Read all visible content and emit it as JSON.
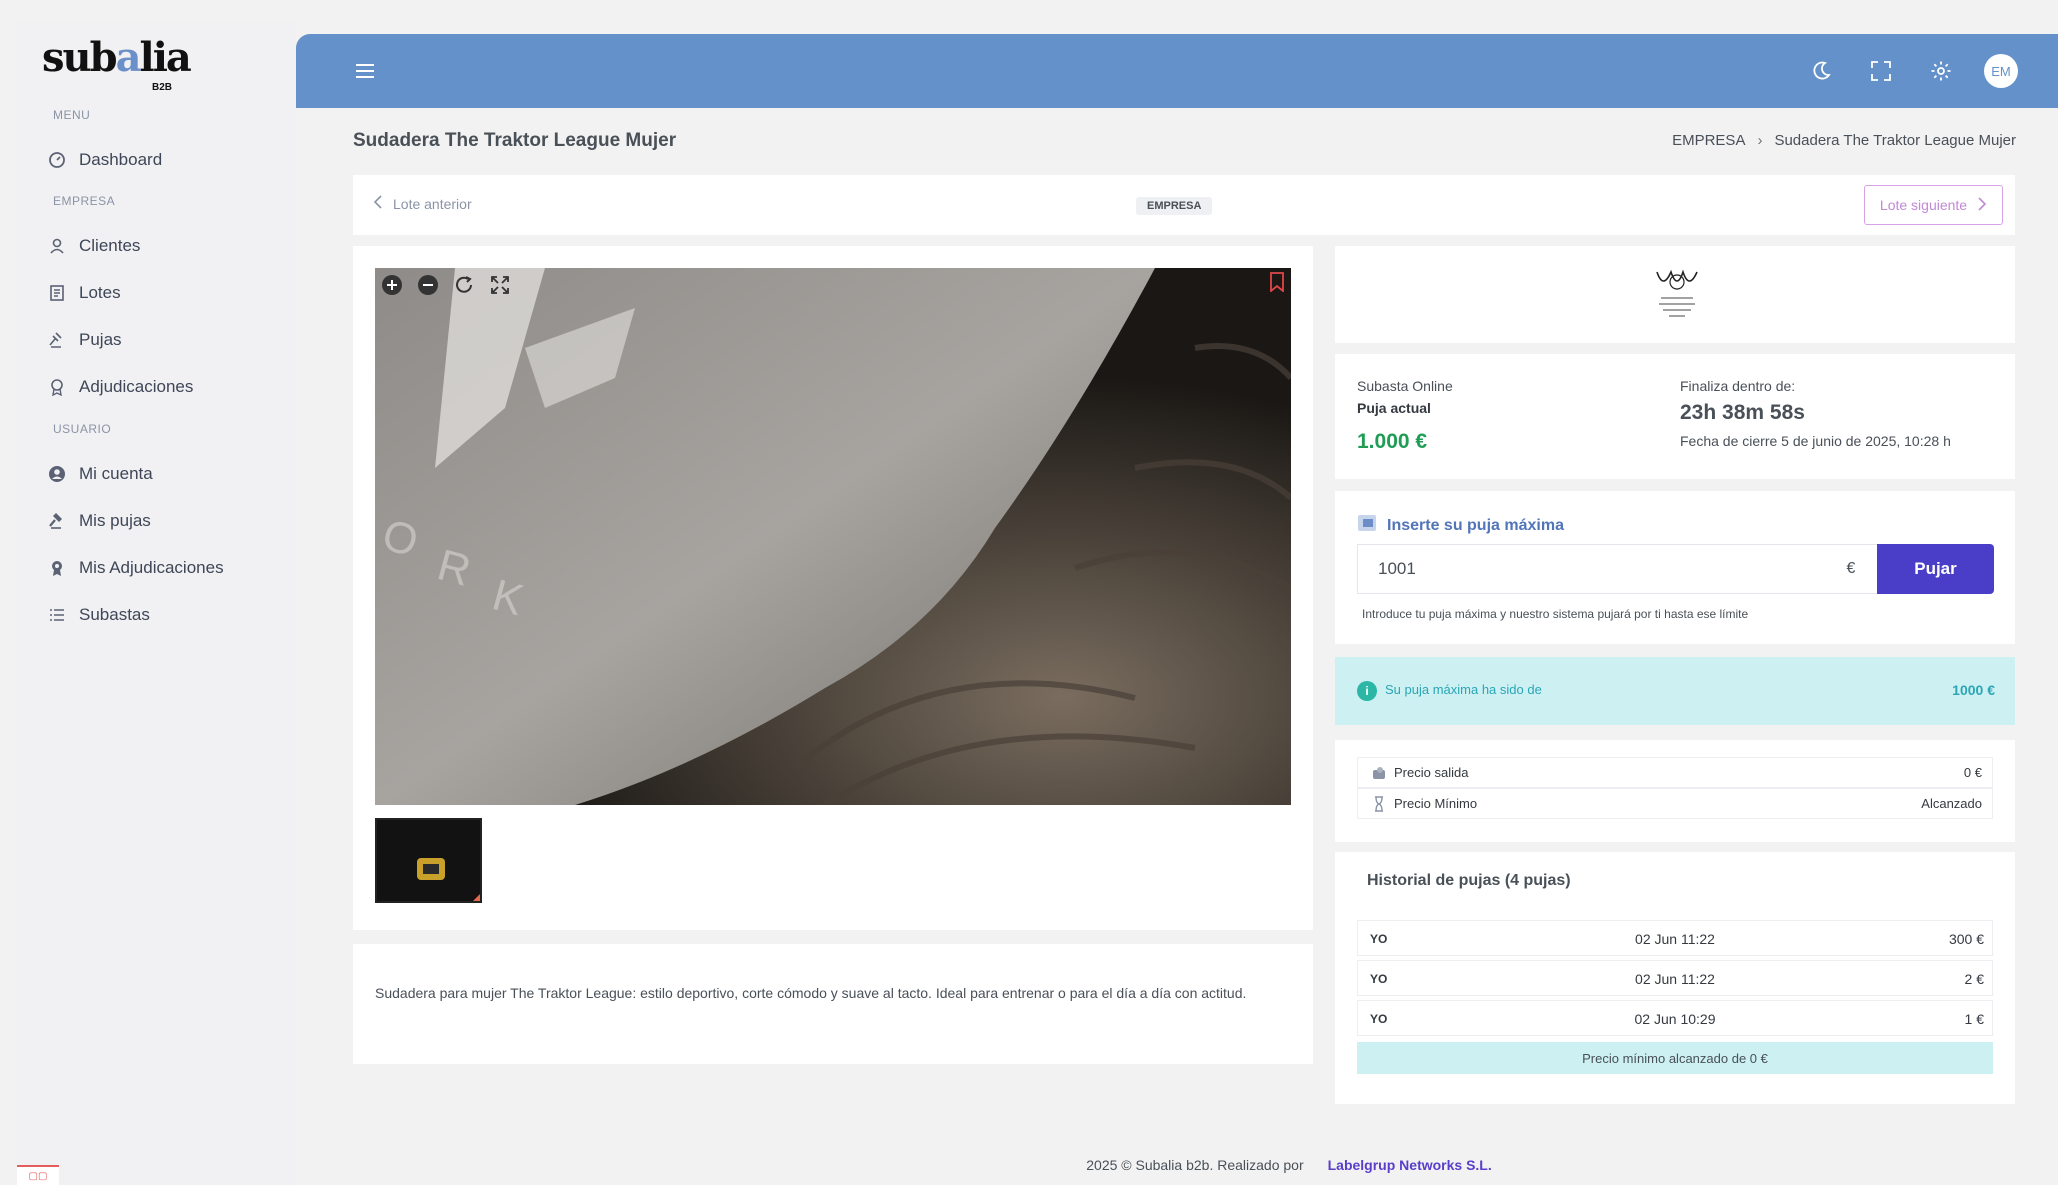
{
  "brand": {
    "logo_main": "subalia",
    "logo_sub": "B2B"
  },
  "sidebar": {
    "sections": [
      {
        "title": "MENU",
        "items": [
          {
            "label": "Dashboard",
            "icon": "dashboard-icon"
          }
        ]
      },
      {
        "title": "EMPRESA",
        "items": [
          {
            "label": "Clientes",
            "icon": "user-icon"
          },
          {
            "label": "Lotes",
            "icon": "document-icon"
          },
          {
            "label": "Pujas",
            "icon": "gavel-icon"
          },
          {
            "label": "Adjudicaciones",
            "icon": "award-icon"
          }
        ]
      },
      {
        "title": "USUARIO",
        "items": [
          {
            "label": "Mi cuenta",
            "icon": "user-circle-icon"
          },
          {
            "label": "Mis pujas",
            "icon": "gavel-solid-icon"
          },
          {
            "label": "Mis Adjudicaciones",
            "icon": "award-solid-icon"
          },
          {
            "label": "Subastas",
            "icon": "list-icon"
          }
        ]
      }
    ]
  },
  "topbar": {
    "avatar_initials": "EM"
  },
  "page": {
    "title": "Sudadera The Traktor League Mujer",
    "breadcrumb": [
      "EMPRESA",
      "Sudadera The Traktor League Mujer"
    ]
  },
  "lot_nav": {
    "prev_label": "Lote anterior",
    "badge": "EMPRESA",
    "next_label": "Lote siguiente"
  },
  "description": "Sudadera para mujer The Traktor League: estilo deportivo, corte cómodo y suave al tacto. Ideal para entrenar o para el día a día con actitud.",
  "auction": {
    "type": "Subasta Online",
    "current_bid_label": "Puja actual",
    "current_bid": "1.000 €",
    "ends_label": "Finaliza dentro de:",
    "countdown": "23h 38m 58s",
    "close_date": "Fecha de cierre 5 de junio de 2025, 10:28 h"
  },
  "bid_form": {
    "title": "Inserte su puja máxima",
    "value": "1001",
    "currency": "€",
    "button": "Pujar",
    "help": "Introduce tu puja máxima y nuestro sistema pujará por ti hasta ese límite"
  },
  "max_bid_info": {
    "text": "Su puja máxima ha sido de",
    "value": "1000 €"
  },
  "prices": [
    {
      "label": "Precio salida",
      "value": "0 €"
    },
    {
      "label": "Precio Mínimo",
      "value": "Alcanzado"
    }
  ],
  "history": {
    "title": "Historial de pujas (4 pujas)",
    "rows": [
      {
        "who": "YO",
        "when": "02 Jun 11:22",
        "amount": "300 €"
      },
      {
        "who": "YO",
        "when": "02 Jun 11:22",
        "amount": "2 €"
      },
      {
        "who": "YO",
        "when": "02 Jun 10:29",
        "amount": "1 €"
      }
    ],
    "footer": "Precio mínimo alcanzado de 0 €"
  },
  "footer": {
    "text": "2025 © Subalia b2b. Realizado por",
    "link": "Labelgrup Networks S.L."
  },
  "colors": {
    "topbar": "#6491c9",
    "accent_button": "#4a3ec9",
    "bid_green": "#1f9d55",
    "info_bg": "#cdf0f2"
  }
}
